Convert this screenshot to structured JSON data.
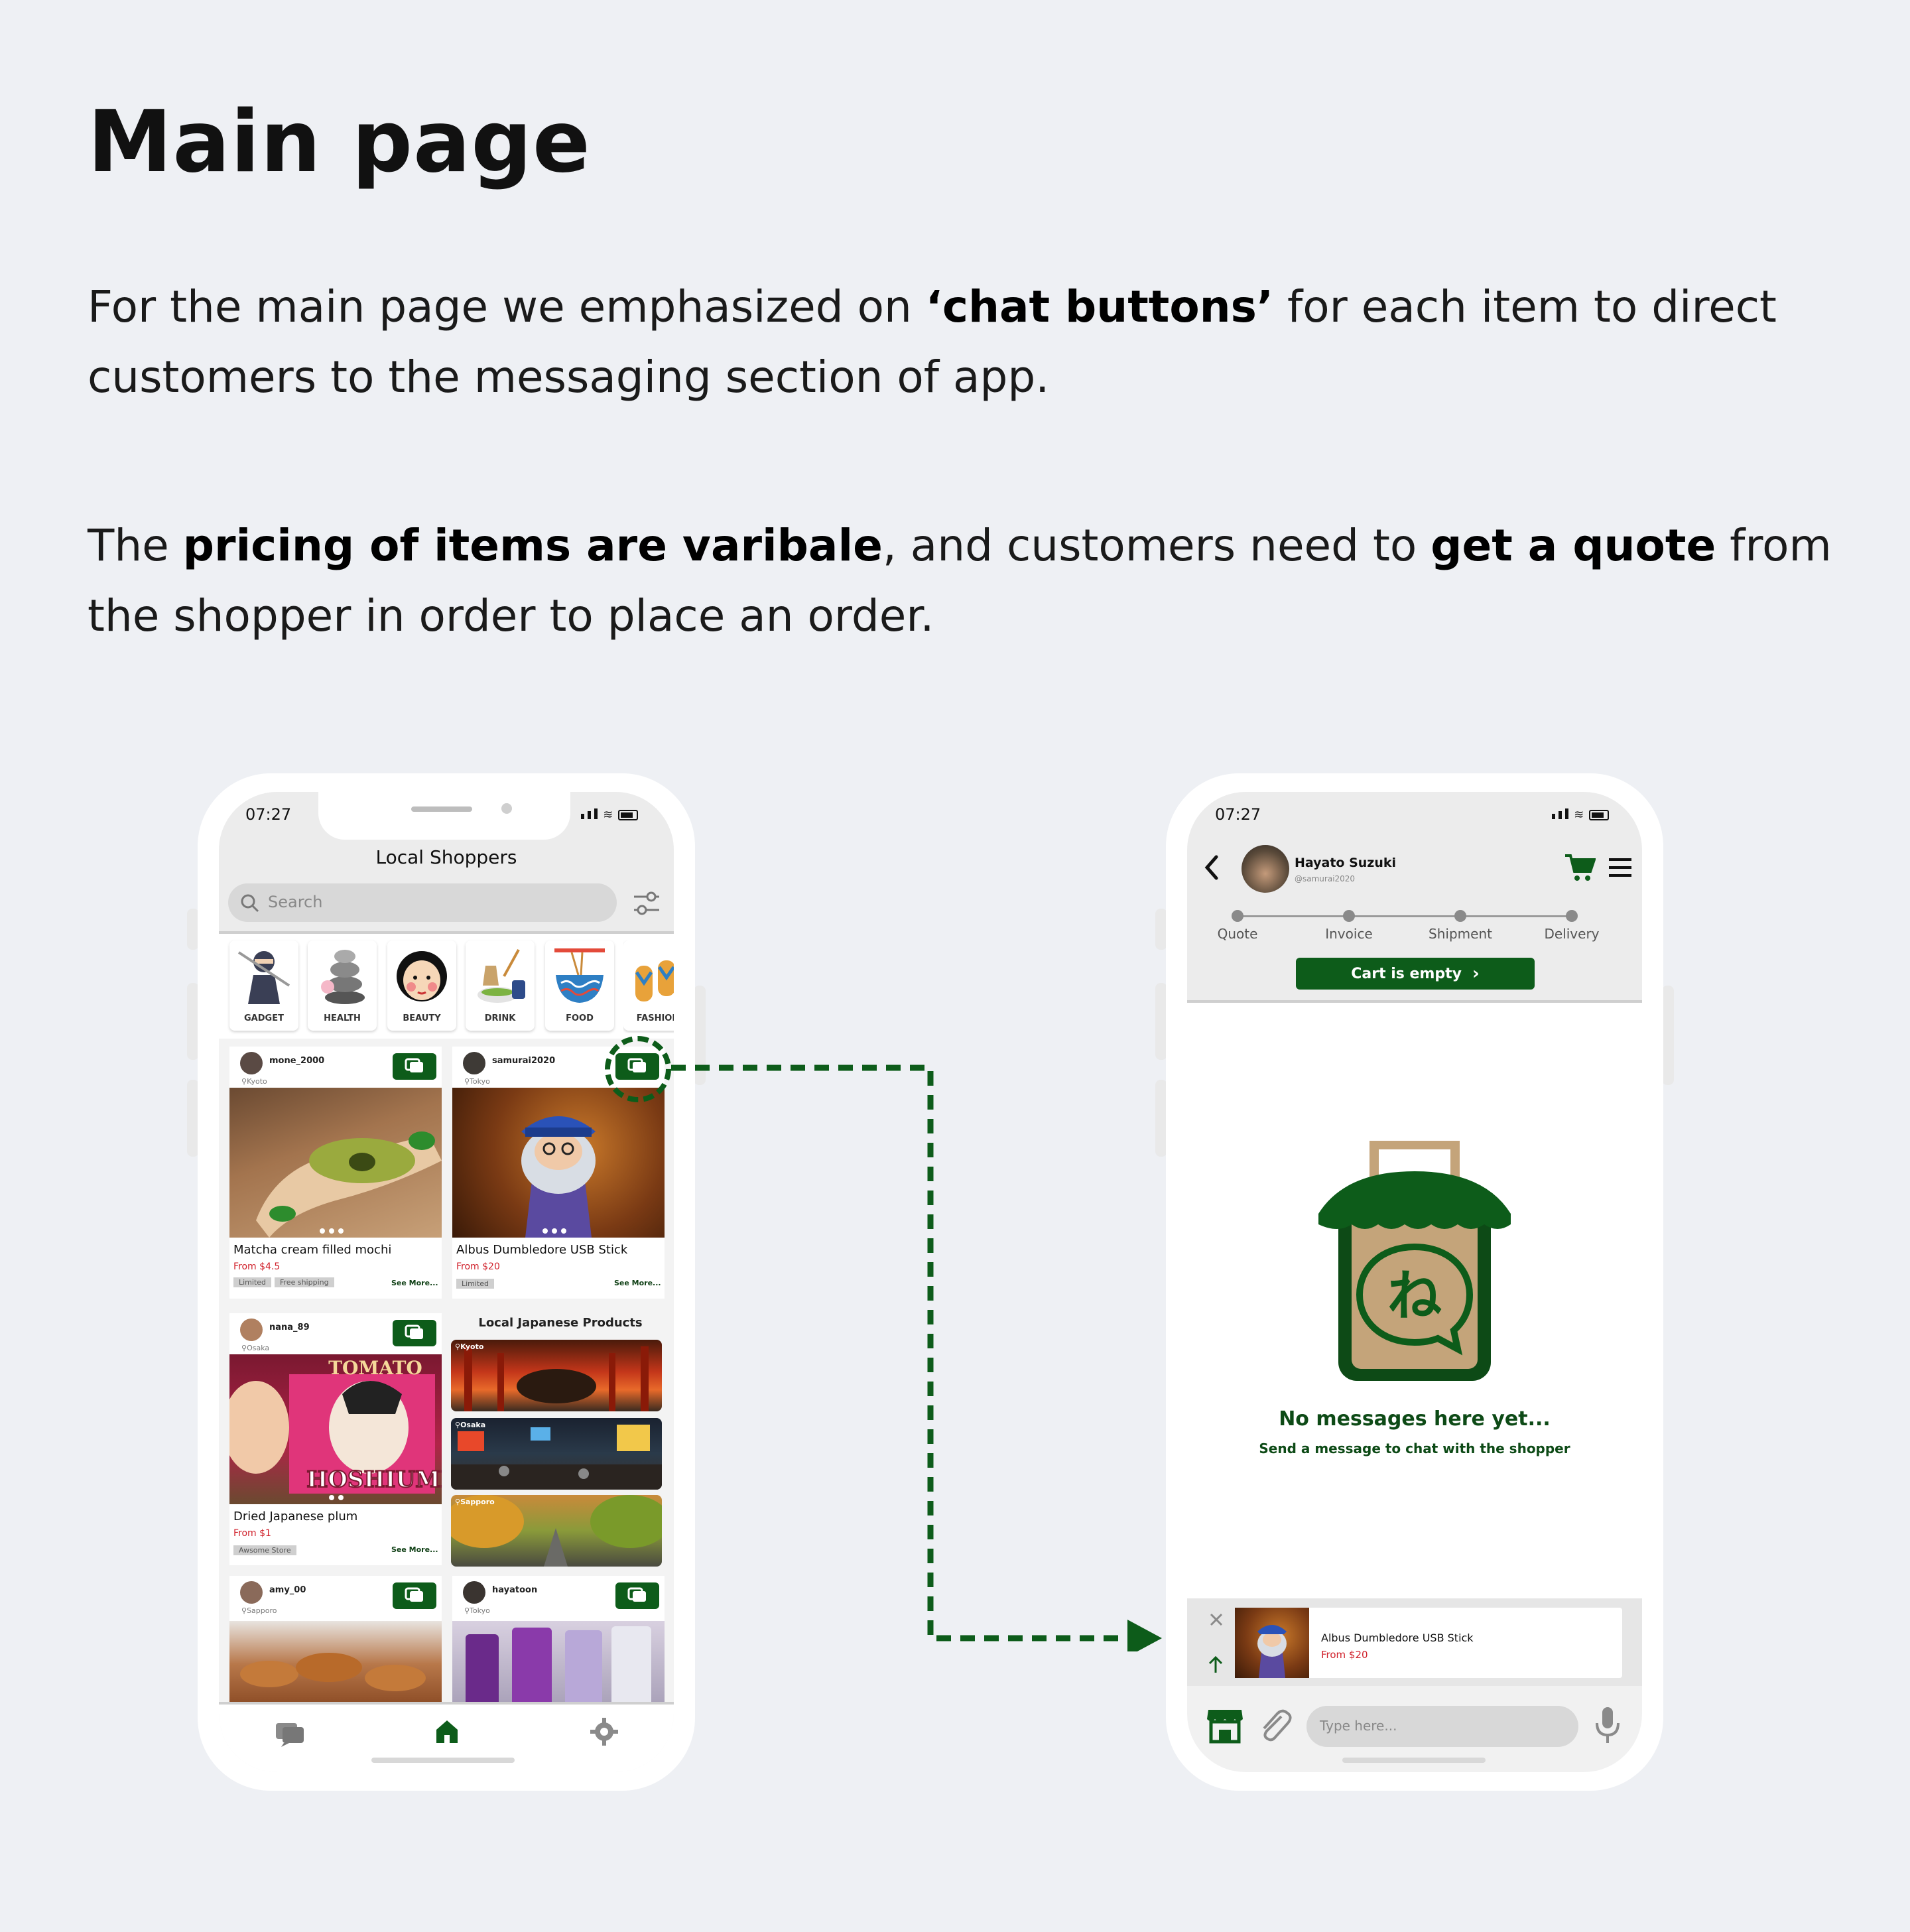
{
  "heading": "Main page",
  "para1": {
    "t1": "For the main page we emphasized on ",
    "b1": "‘chat buttons’",
    "t2": " for each item to direct customers to the messaging section of app."
  },
  "para2": {
    "t1": "The ",
    "b1": "pricing of items are varibale",
    "t2": ", and customers need to ",
    "b2": "get a quote",
    "t3": " from the shopper in order to place an order."
  },
  "phone1": {
    "time": "07:27",
    "app_title": "Local Shoppers",
    "search_placeholder": "Search",
    "categories": [
      "GADGET",
      "HEALTH",
      "BEAUTY",
      "DRINK",
      "FOOD",
      "FASHION"
    ],
    "cards": [
      {
        "user": "mone_2000",
        "loc": "Kyoto",
        "name": "Matcha cream filled mochi",
        "price": "From $4.5",
        "tags": [
          "Limited",
          "Free shipping"
        ],
        "more": "See More..."
      },
      {
        "user": "samurai2020",
        "loc": "Tokyo",
        "name": "Albus Dumbledore USB Stick",
        "price": "From $20",
        "tags": [
          "Limited"
        ],
        "more": "See More..."
      },
      {
        "user": "nana_89",
        "loc": "Osaka",
        "name": "Dried Japanese plum",
        "price": "From $1",
        "tags": [
          "Awsome Store"
        ],
        "more": "See More..."
      },
      {
        "user": "amy_00",
        "loc": "Sapporo"
      },
      {
        "user": "hayatoon",
        "loc": "Tokyo"
      }
    ],
    "photo_text": {
      "tomato": "TOMATO",
      "hoshiume": "HOSHIUME"
    },
    "local_title": "Local Japanese Products",
    "cities": [
      "Kyoto",
      "Osaka",
      "Sapporo"
    ]
  },
  "phone2": {
    "time": "07:27",
    "shopper_name": "Hayato Suzuki",
    "shopper_handle": "@samurai2020",
    "steps": [
      "Quote",
      "Invoice",
      "Shipment",
      "Delivery"
    ],
    "cart_label": "Cart is empty",
    "logo_glyph": "ね",
    "empty_title": "No messages here yet...",
    "empty_sub": "Send a message to chat with the shopper",
    "attached_item": {
      "name": "Albus Dumbledore USB Stick",
      "price": "From $20"
    },
    "input_placeholder": "Type here..."
  },
  "colors": {
    "brand_green": "#0d5c1a",
    "price_red": "#d0212b",
    "background": "#eef0f4"
  },
  "icons": [
    "search-icon",
    "filter-icon",
    "chat-icon",
    "home-icon",
    "gear-icon",
    "back-icon",
    "cart-icon",
    "menu-icon",
    "close-icon",
    "arrow-up-icon",
    "store-icon",
    "paperclip-icon",
    "mic-icon"
  ]
}
